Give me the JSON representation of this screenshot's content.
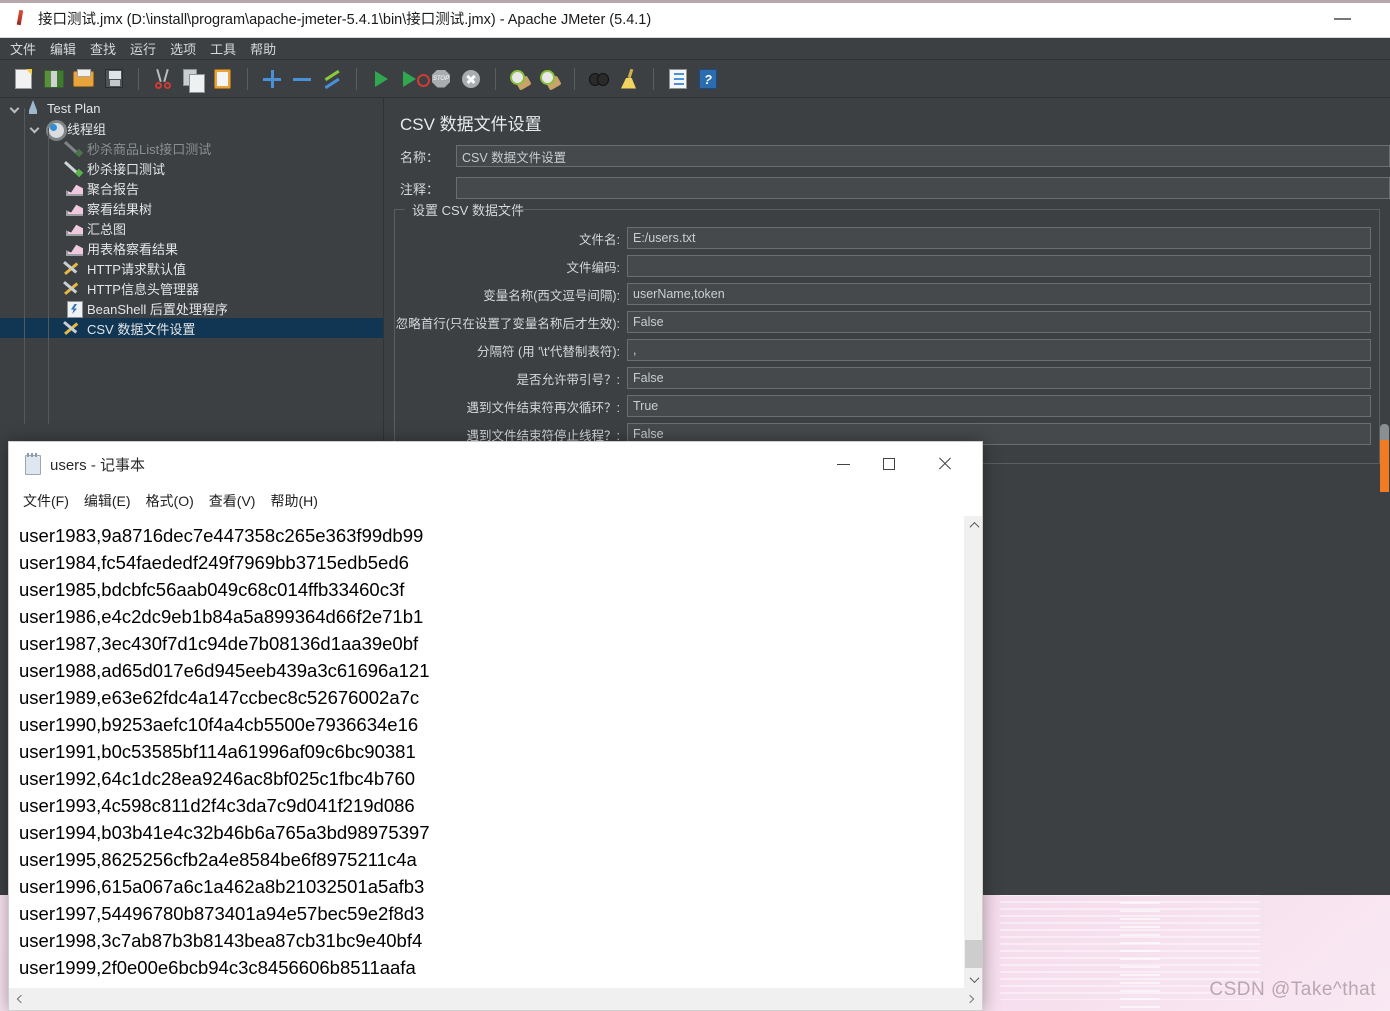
{
  "jmeter": {
    "title": "接口测试.jmx (D:\\install\\program\\apache-jmeter-5.4.1\\bin\\接口测试.jmx) - Apache JMeter (5.4.1)",
    "title_icon": "jmeter-feather-icon",
    "minimize_label": "最小化",
    "menus": [
      "文件",
      "编辑",
      "查找",
      "运行",
      "选项",
      "工具",
      "帮助"
    ],
    "toolbar": [
      {
        "name": "new-icon",
        "tip": "新建"
      },
      {
        "name": "templates-icon",
        "tip": "模板"
      },
      {
        "name": "open-icon",
        "tip": "打开"
      },
      {
        "name": "save-icon",
        "tip": "保存"
      },
      {
        "name": "separator",
        "tip": ""
      },
      {
        "name": "cut-icon",
        "tip": "剪切"
      },
      {
        "name": "copy-icon",
        "tip": "复制"
      },
      {
        "name": "paste-icon",
        "tip": "粘贴"
      },
      {
        "name": "separator",
        "tip": ""
      },
      {
        "name": "expand-icon",
        "tip": "展开全部"
      },
      {
        "name": "collapse-icon",
        "tip": "折叠全部"
      },
      {
        "name": "toggle-icon",
        "tip": "启用/禁用"
      },
      {
        "name": "separator",
        "tip": ""
      },
      {
        "name": "start-icon",
        "tip": "启动"
      },
      {
        "name": "start-no-pauses-icon",
        "tip": "无间隔启动"
      },
      {
        "name": "stop-icon",
        "tip": "停止"
      },
      {
        "name": "shutdown-icon",
        "tip": "关闭"
      },
      {
        "name": "separator",
        "tip": ""
      },
      {
        "name": "clear-icon",
        "tip": "清除"
      },
      {
        "name": "clear-all-icon",
        "tip": "清除全部"
      },
      {
        "name": "separator",
        "tip": ""
      },
      {
        "name": "search-icon",
        "tip": "搜索"
      },
      {
        "name": "reset-search-icon",
        "tip": "重置搜索"
      },
      {
        "name": "separator",
        "tip": ""
      },
      {
        "name": "function-helper-icon",
        "tip": "函数助手对话框"
      },
      {
        "name": "help-icon",
        "tip": "帮助"
      }
    ],
    "tree": [
      {
        "label": "Test Plan",
        "icon": "test-plan-icon",
        "depth": 0,
        "twisty": "down",
        "selected": false,
        "disabled": false
      },
      {
        "label": "线程组",
        "icon": "thread-group-icon",
        "depth": 1,
        "twisty": "down",
        "selected": false,
        "disabled": false
      },
      {
        "label": "秒杀商品List接口测试",
        "icon": "http-sampler-icon",
        "depth": 2,
        "twisty": "none",
        "selected": false,
        "disabled": true
      },
      {
        "label": "秒杀接口测试",
        "icon": "http-sampler-icon",
        "depth": 2,
        "twisty": "none",
        "selected": false,
        "disabled": false
      },
      {
        "label": "聚合报告",
        "icon": "listener-icon",
        "depth": 2,
        "twisty": "none",
        "selected": false,
        "disabled": false
      },
      {
        "label": "察看结果树",
        "icon": "listener-icon",
        "depth": 2,
        "twisty": "none",
        "selected": false,
        "disabled": false
      },
      {
        "label": "汇总图",
        "icon": "listener-icon",
        "depth": 2,
        "twisty": "none",
        "selected": false,
        "disabled": false
      },
      {
        "label": "用表格察看结果",
        "icon": "listener-icon",
        "depth": 2,
        "twisty": "none",
        "selected": false,
        "disabled": false
      },
      {
        "label": "HTTP请求默认值",
        "icon": "config-element-icon",
        "depth": 2,
        "twisty": "none",
        "selected": false,
        "disabled": false
      },
      {
        "label": "HTTP信息头管理器",
        "icon": "config-element-icon",
        "depth": 2,
        "twisty": "none",
        "selected": false,
        "disabled": false
      },
      {
        "label": "BeanShell 后置处理程序",
        "icon": "beanshell-icon",
        "depth": 2,
        "twisty": "none",
        "selected": false,
        "disabled": false
      },
      {
        "label": "CSV 数据文件设置",
        "icon": "config-element-icon",
        "depth": 2,
        "twisty": "none",
        "selected": true,
        "disabled": false
      }
    ],
    "config": {
      "title": "CSV 数据文件设置",
      "name_label": "名称：",
      "name_value": "CSV 数据文件设置",
      "comment_label": "注释：",
      "comment_value": "",
      "group_legend": "设置 CSV 数据文件",
      "fields": [
        {
          "label": "文件名:",
          "value": "E:/users.txt"
        },
        {
          "label": "文件编码:",
          "value": ""
        },
        {
          "label": "变量名称(西文逗号间隔):",
          "value": "userName,token"
        },
        {
          "label": "忽略首行(只在设置了变量名称后才生效):",
          "value": "False"
        },
        {
          "label": "分隔符 (用 '\\t'代替制表符):",
          "value": ","
        },
        {
          "label": "是否允许带引号？:",
          "value": "False"
        },
        {
          "label": "遇到文件结束符再次循环？:",
          "value": "True"
        },
        {
          "label": "遇到文件结束符停止线程？:",
          "value": "False"
        }
      ]
    },
    "scrollbar_color": "#f07b22"
  },
  "notepad": {
    "title": "users - 记事本",
    "icon": "notepad-icon",
    "controls": {
      "minimize": "最小化",
      "maximize": "最大化",
      "close": "关闭"
    },
    "menus": [
      "文件(F)",
      "编辑(E)",
      "格式(O)",
      "查看(V)",
      "帮助(H)"
    ],
    "lines": [
      "user1983,9a8716dec7e447358c265e363f99db99",
      "user1984,fc54faededf249f7969bb3715edb5ed6",
      "user1985,bdcbfc56aab049c68c014ffb33460c3f",
      "user1986,e4c2dc9eb1b84a5a899364d66f2e71b1",
      "user1987,3ec430f7d1c94de7b08136d1aa39e0bf",
      "user1988,ad65d017e6d945eeb439a3c61696a121",
      "user1989,e63e62fdc4a147ccbec8c52676002a7c",
      "user1990,b9253aefc10f4a4cb5500e7936634e16",
      "user1991,b0c53585bf114a61996af09c6bc90381",
      "user1992,64c1dc28ea9246ac8bf025c1fbc4b760",
      "user1993,4c598c811d2f4c3da7c9d041f219d086",
      "user1994,b03b41e4c32b46b6a765a3bd98975397",
      "user1995,8625256cfb2a4e8584be6f8975211c4a",
      "user1996,615a067a6c1a462a8b21032501a5afb3",
      "user1997,54496780b873401a94e57bec59e2f8d3",
      "user1998,3c7ab87b3b8143bea87cb31bc9e40bf4",
      "user1999,2f0e00e6bcb94c3c8456606b8511aafa"
    ]
  },
  "desktop": {
    "watermark": "CSDN @Take^that",
    "background_color": "#f8e3f0"
  }
}
